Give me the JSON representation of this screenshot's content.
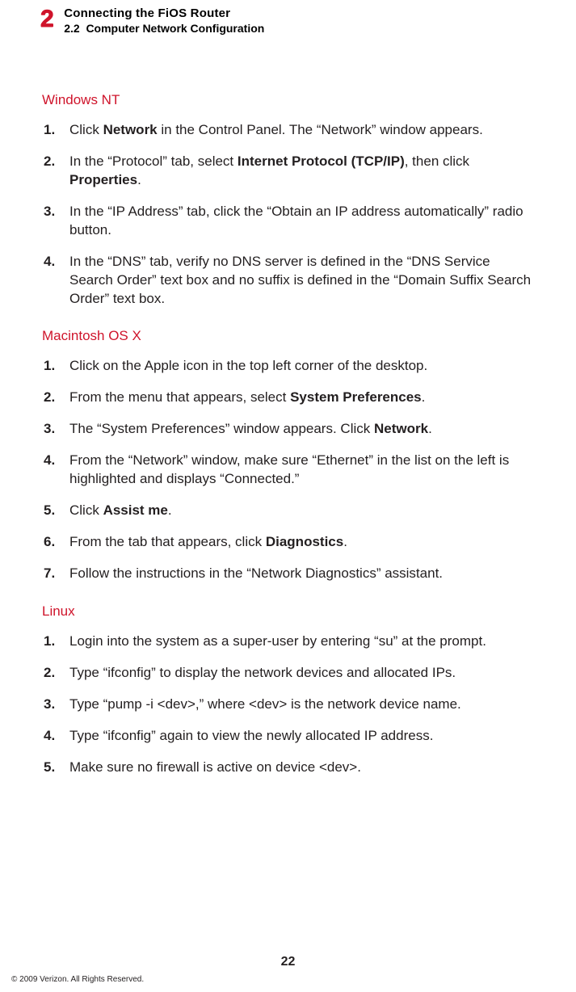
{
  "header": {
    "chapter_num": "2",
    "chapter_title": "Connecting the FiOS Router",
    "section_num": "2.2",
    "section_title": "Computer Network Configuration"
  },
  "sections": {
    "winnt": {
      "heading": "Windows NT",
      "steps": {
        "s1_a": "Click ",
        "s1_b": "Network",
        "s1_c": " in the Control Panel. The “Network” window appears.",
        "s2_a": "In the “Protocol” tab, select ",
        "s2_b": "Internet Protocol (TCP/IP)",
        "s2_c": ", then click ",
        "s2_d": "Properties",
        "s2_e": ".",
        "s3": "In the “IP Address” tab,  click the “Obtain an IP address automatically” radio button.",
        "s4": "In the “DNS” tab, verify no DNS server is defined in the “DNS Service Search Order” text box and no suffix is defined in the “Domain Suffix Search Order” text box."
      }
    },
    "macosx": {
      "heading": "Macintosh OS X",
      "steps": {
        "s1": "Click on the Apple icon in the top left corner of the desktop.",
        "s2_a": "From the menu that appears, select ",
        "s2_b": "System Preferences",
        "s2_c": ".",
        "s3_a": "The “System Preferences” window appears. Click ",
        "s3_b": "Network",
        "s3_c": ".",
        "s4": "From the “Network” window, make sure “Ethernet” in the list on the left is highlighted and displays “Connected.”",
        "s5_a": "Click ",
        "s5_b": "Assist me",
        "s5_c": ".",
        "s6_a": "From the tab that appears, click ",
        "s6_b": "Diagnostics",
        "s6_c": ".",
        "s7": "Follow the instructions in the “Network Diagnostics” assistant."
      }
    },
    "linux": {
      "heading": "Linux",
      "steps": {
        "s1": "Login into the system as a super-user by entering “su” at the prompt.",
        "s2": "Type “ifconfig” to display the network devices and allocated IPs.",
        "s3": "Type “pump -i <dev>,” where <dev> is the network device name.",
        "s4": "Type “ifconfig” again to view the newly allocated IP address.",
        "s5": "Make sure no firewall is active on device <dev>."
      }
    }
  },
  "page_number": "22",
  "copyright": "© 2009 Verizon. All Rights Reserved."
}
